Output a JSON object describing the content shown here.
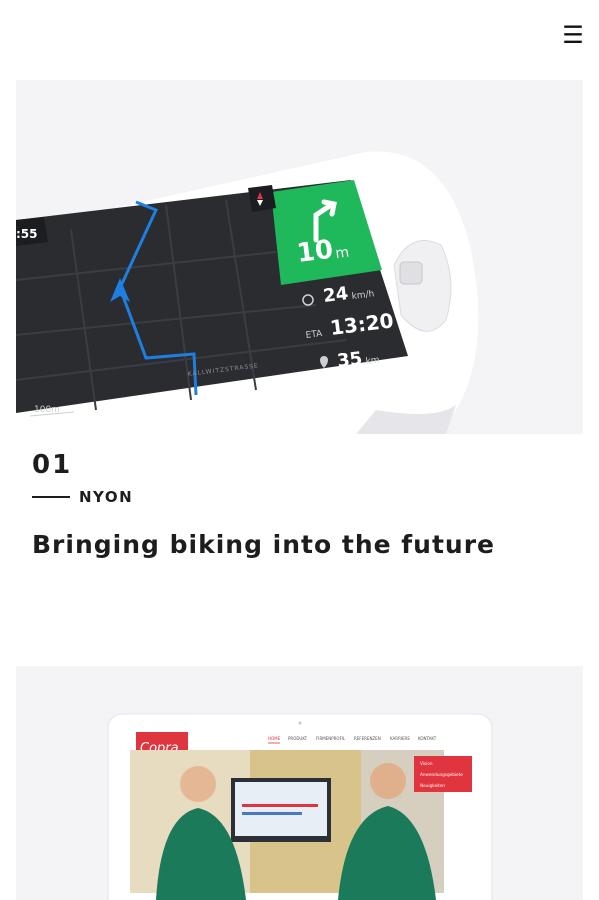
{
  "header": {
    "menu_icon": "hamburger-menu-icon",
    "menu_glyph": "☰"
  },
  "projects": [
    {
      "image": {
        "speed_value": "24",
        "speed_unit": "km/h",
        "turn_distance": "10",
        "turn_unit": "m",
        "eta_label": "ETA",
        "eta_time": "13:20",
        "remaining_distance": "35",
        "remaining_unit": "km",
        "map_scale": "100m",
        "clock_partial": ":55",
        "street_label": "KALLWITZSTRASSE",
        "icons": [
          "turn-arrow-icon",
          "speedometer-icon",
          "location-pin-icon",
          "compass-icon"
        ]
      },
      "number": "01",
      "client": "NYON",
      "title": "Bringing biking into the future"
    },
    {
      "image": {
        "logo_text": "Copra",
        "nav": [
          "HOME",
          "PRODUKT",
          "FIRMENPROFIL",
          "REFERENZEN",
          "KARRIERE",
          "KONTAKT"
        ],
        "side_menu": [
          "Vision",
          "Anwendungsgebiete",
          "Neuigkeiten"
        ]
      }
    }
  ],
  "colors": {
    "accent_green": "#1fb85a",
    "route_blue": "#1e7fe0",
    "copra_red": "#e0343f",
    "card_bg": "#f4f4f6",
    "text": "#1d1d1f"
  }
}
